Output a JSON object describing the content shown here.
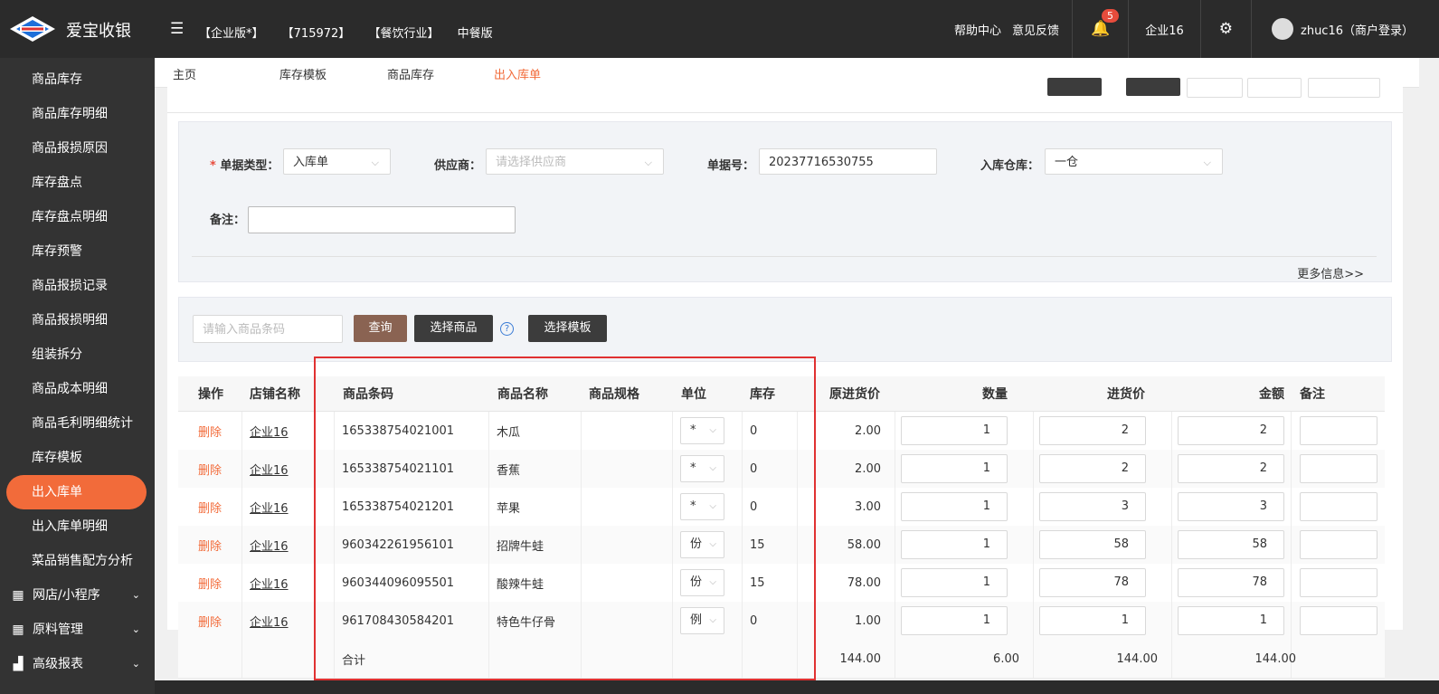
{
  "app": {
    "title": "爱宝收银"
  },
  "header": {
    "tags": [
      "【企业版*】",
      "【715972】",
      "【餐饮行业】",
      "中餐版"
    ],
    "help": "帮助中心",
    "feedback": "意见反馈",
    "notifications": "5",
    "company": "企业16",
    "user": "zhuc16（商户登录）"
  },
  "sidebar": {
    "items": [
      "商品库存",
      "商品库存明细",
      "商品报损原因",
      "库存盘点",
      "库存盘点明细",
      "库存预警",
      "商品报损记录",
      "商品报损明细",
      "组装拆分",
      "商品成本明细",
      "商品毛利明细统计",
      "库存模板",
      "出入库单",
      "出入库单明细",
      "菜品销售配方分析"
    ],
    "groups": [
      "网店/小程序",
      "原料管理",
      "高级报表"
    ]
  },
  "tabs": [
    "主页",
    "库存模板",
    "商品库存",
    "出入库单"
  ],
  "form": {
    "type_label": "单据类型：",
    "type_value": "入库单",
    "supplier_label": "供应商：",
    "supplier_placeholder": "请选择供应商",
    "no_label": "单据号：",
    "no_value": "20237716530755",
    "warehouse_label": "入库仓库：",
    "warehouse_value": "一仓",
    "remark_label": "备注：",
    "more": "更多信息>>"
  },
  "search": {
    "placeholder": "请输入商品条码",
    "query": "查询",
    "select_goods": "选择商品",
    "select_template": "选择模板"
  },
  "table": {
    "headers": [
      "操作",
      "店铺名称",
      "商品条码",
      "商品名称",
      "商品规格",
      "单位",
      "库存",
      "原进货价",
      "数量",
      "进货价",
      "金额",
      "备注"
    ],
    "rows": [
      {
        "op": "删除",
        "shop": "企业16",
        "barcode": "165338754021001",
        "name": "木瓜",
        "spec": "",
        "unit": "*",
        "stock": "0",
        "orig": "2.00",
        "qty": "1",
        "price": "2",
        "amount": "2"
      },
      {
        "op": "删除",
        "shop": "企业16",
        "barcode": "165338754021101",
        "name": "香蕉",
        "spec": "",
        "unit": "*",
        "stock": "0",
        "orig": "2.00",
        "qty": "1",
        "price": "2",
        "amount": "2"
      },
      {
        "op": "删除",
        "shop": "企业16",
        "barcode": "165338754021201",
        "name": "苹果",
        "spec": "",
        "unit": "*",
        "stock": "0",
        "orig": "3.00",
        "qty": "1",
        "price": "3",
        "amount": "3"
      },
      {
        "op": "删除",
        "shop": "企业16",
        "barcode": "960342261956101",
        "name": "招牌牛蛙",
        "spec": "",
        "unit": "份",
        "stock": "15",
        "orig": "58.00",
        "qty": "1",
        "price": "58",
        "amount": "58"
      },
      {
        "op": "删除",
        "shop": "企业16",
        "barcode": "960344096095501",
        "name": "酸辣牛蛙",
        "spec": "",
        "unit": "份",
        "stock": "15",
        "orig": "78.00",
        "qty": "1",
        "price": "78",
        "amount": "78"
      },
      {
        "op": "删除",
        "shop": "企业16",
        "barcode": "961708430584201",
        "name": "特色牛仔骨",
        "spec": "",
        "unit": "例",
        "stock": "0",
        "orig": "1.00",
        "qty": "1",
        "price": "1",
        "amount": "1"
      }
    ],
    "total": {
      "label": "合计",
      "orig": "144.00",
      "qty": "6.00",
      "price": "144.00",
      "amount": "144.00"
    }
  },
  "colors": {
    "accent": "#f26b3a",
    "topbar": "#2b2b2b",
    "sidebar": "#333333",
    "highlight": "#e03131"
  }
}
